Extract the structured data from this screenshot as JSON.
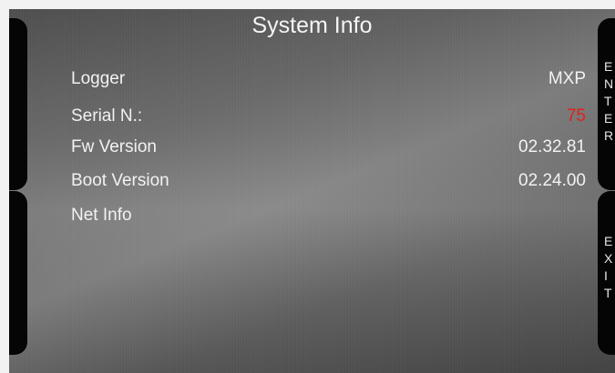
{
  "screen": {
    "title": "System Info"
  },
  "info_rows": [
    {
      "label": "Logger",
      "value": "MXP",
      "value_color": "#f2f2f2"
    },
    {
      "label": "Serial N.:",
      "value": "75",
      "value_color": "#e0231b"
    },
    {
      "label": "Fw Version",
      "value": "02.32.81",
      "value_color": "#f2f2f2"
    },
    {
      "label": "Boot Version",
      "value": "02.24.00",
      "value_color": "#f2f2f2"
    },
    {
      "label": "Net Info",
      "value": "",
      "value_color": "#f2f2f2"
    }
  ],
  "softkeys": {
    "right_top_letters": [
      "E",
      "N",
      "T",
      "E",
      "R"
    ],
    "right_bottom_letters": [
      "E",
      "X",
      "I",
      "T"
    ]
  },
  "colors": {
    "background": "#5a5a5a",
    "softkey": "#050505",
    "text": "#f2f2f2",
    "highlight": "#e0231b"
  }
}
